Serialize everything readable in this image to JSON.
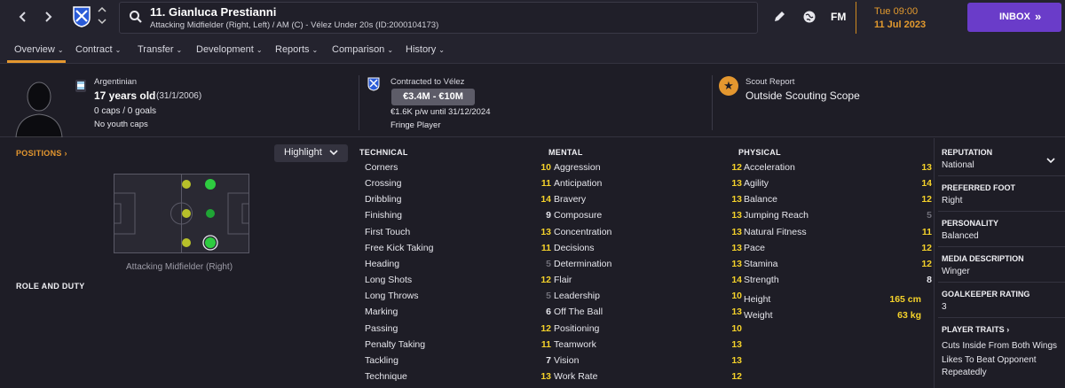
{
  "topbar": {
    "player_name": "11. Gianluca Prestianni",
    "player_subtitle": "Attacking Midfielder (Right, Left) / AM (C) - Vélez Under 20s (ID:2000104173)",
    "fm_label": "FM",
    "date_day": "Tue 09:00",
    "date_full": "11 Jul 2023",
    "inbox_label": "INBOX",
    "inbox_arrows": "»"
  },
  "tabs": [
    {
      "label": "Overview"
    },
    {
      "label": "Contract"
    },
    {
      "label": "Transfer"
    },
    {
      "label": "Development"
    },
    {
      "label": "Reports"
    },
    {
      "label": "Comparison"
    },
    {
      "label": "History"
    }
  ],
  "profile": {
    "nationality": "Argentinian",
    "age": "17 years old",
    "dob": "(31/1/2006)",
    "caps": "0 caps / 0 goals",
    "youth_caps": "No youth caps"
  },
  "contract": {
    "label": "Contracted to Vélez",
    "value": "€3.4M - €10M",
    "wage": "€1.6K p/w until 31/12/2024",
    "status": "Fringe Player"
  },
  "scout": {
    "label": "Scout Report",
    "value": "Outside Scouting Scope"
  },
  "positions": {
    "heading": "POSITIONS",
    "heading_arrow": "›",
    "highlight_label": "Highlight",
    "position_label": "Attacking Midfielder (Right)",
    "role_heading": "ROLE AND DUTY"
  },
  "colors": {
    "accent": "#e4972f",
    "rating_good": "#2ecc40",
    "rating_ok": "#b7c02a",
    "inbox": "#6a3cc9",
    "val_high": "#f5d22a",
    "val_mid": "#e6e6ec",
    "val_low": "#6f6e78"
  },
  "technical": {
    "heading": "TECHNICAL",
    "items": [
      {
        "name": "Corners",
        "value": "10"
      },
      {
        "name": "Crossing",
        "value": "11"
      },
      {
        "name": "Dribbling",
        "value": "14"
      },
      {
        "name": "Finishing",
        "value": "9"
      },
      {
        "name": "First Touch",
        "value": "13"
      },
      {
        "name": "Free Kick Taking",
        "value": "11"
      },
      {
        "name": "Heading",
        "value": "5"
      },
      {
        "name": "Long Shots",
        "value": "12"
      },
      {
        "name": "Long Throws",
        "value": "5"
      },
      {
        "name": "Marking",
        "value": "6"
      },
      {
        "name": "Passing",
        "value": "12"
      },
      {
        "name": "Penalty Taking",
        "value": "11"
      },
      {
        "name": "Tackling",
        "value": "7"
      },
      {
        "name": "Technique",
        "value": "13"
      }
    ]
  },
  "mental": {
    "heading": "MENTAL",
    "items": [
      {
        "name": "Aggression",
        "value": "12"
      },
      {
        "name": "Anticipation",
        "value": "13"
      },
      {
        "name": "Bravery",
        "value": "13"
      },
      {
        "name": "Composure",
        "value": "13"
      },
      {
        "name": "Concentration",
        "value": "13"
      },
      {
        "name": "Decisions",
        "value": "13"
      },
      {
        "name": "Determination",
        "value": "13"
      },
      {
        "name": "Flair",
        "value": "14"
      },
      {
        "name": "Leadership",
        "value": "10"
      },
      {
        "name": "Off The Ball",
        "value": "13"
      },
      {
        "name": "Positioning",
        "value": "10"
      },
      {
        "name": "Teamwork",
        "value": "13"
      },
      {
        "name": "Vision",
        "value": "13"
      },
      {
        "name": "Work Rate",
        "value": "12"
      }
    ]
  },
  "physical": {
    "heading": "PHYSICAL",
    "items": [
      {
        "name": "Acceleration",
        "value": "13"
      },
      {
        "name": "Agility",
        "value": "14"
      },
      {
        "name": "Balance",
        "value": "12"
      },
      {
        "name": "Jumping Reach",
        "value": "5"
      },
      {
        "name": "Natural Fitness",
        "value": "11"
      },
      {
        "name": "Pace",
        "value": "12"
      },
      {
        "name": "Stamina",
        "value": "12"
      },
      {
        "name": "Strength",
        "value": "8"
      }
    ],
    "height_label": "Height",
    "height_value": "165 cm",
    "weight_label": "Weight",
    "weight_value": "63 kg"
  },
  "info": {
    "reputation_head": "REPUTATION",
    "reputation": "National",
    "foot_head": "PREFERRED FOOT",
    "foot": "Right",
    "personality_head": "PERSONALITY",
    "personality": "Balanced",
    "media_head": "MEDIA DESCRIPTION",
    "media": "Winger",
    "gk_head": "GOALKEEPER RATING",
    "gk": "3",
    "traits_head": "PLAYER TRAITS",
    "traits_arrow": "›",
    "trait1": "Cuts Inside From Both Wings",
    "trait2a": "Likes To Beat Opponent",
    "trait2b": "Repeatedly"
  }
}
